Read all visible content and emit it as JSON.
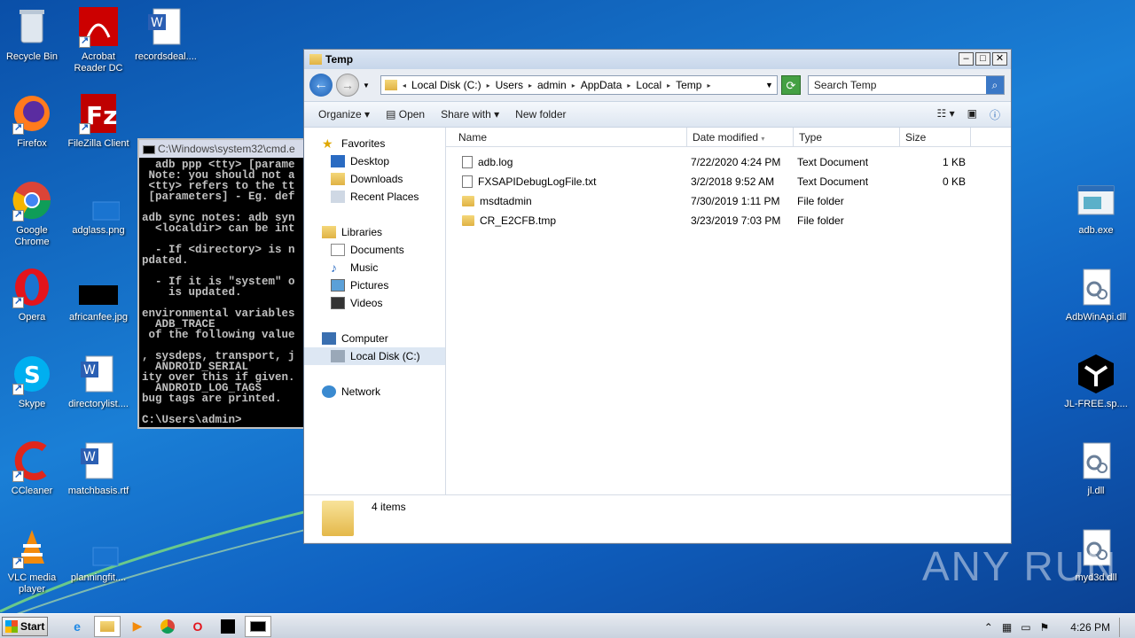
{
  "desktop": {
    "left_icons": [
      {
        "label": "Recycle Bin",
        "icon": "recycle-bin-icon"
      },
      {
        "label": "Acrobat Reader DC",
        "icon": "acrobat-icon"
      },
      {
        "label": "recordsdeal....",
        "icon": "word-doc-icon"
      },
      {
        "label": "Firefox",
        "icon": "firefox-icon"
      },
      {
        "label": "FileZilla Client",
        "icon": "filezilla-icon"
      },
      {
        "label": "Google Chrome",
        "icon": "chrome-icon"
      },
      {
        "label": "adglass.png",
        "icon": "image-file-icon"
      },
      {
        "label": "Opera",
        "icon": "opera-icon"
      },
      {
        "label": "africanfee.jpg",
        "icon": "image-file-icon"
      },
      {
        "label": "Skype",
        "icon": "skype-icon"
      },
      {
        "label": "directorylist....",
        "icon": "word-doc-icon"
      },
      {
        "label": "CCleaner",
        "icon": "ccleaner-icon"
      },
      {
        "label": "matchbasis.rtf",
        "icon": "word-doc-icon"
      },
      {
        "label": "VLC media player",
        "icon": "vlc-icon"
      },
      {
        "label": "planningfit....",
        "icon": "file-icon"
      }
    ],
    "right_icons": [
      {
        "label": "adb.exe",
        "icon": "exe-icon"
      },
      {
        "label": "AdbWinApi.dll",
        "icon": "dll-icon"
      },
      {
        "label": "JL-FREE.sp....",
        "icon": "package-icon"
      },
      {
        "label": "jl.dll",
        "icon": "dll-icon"
      },
      {
        "label": "myd3d.dll",
        "icon": "dll-icon"
      }
    ]
  },
  "cmd": {
    "title": "C:\\Windows\\system32\\cmd.e",
    "lines": "  adb ppp <tty> [parame\n Note: you should not a\n <tty> refers to the tt\n [parameters] - Eg. def\n\nadb sync notes: adb syn\n  <localdir> can be int\n\n  - If <directory> is n\npdated.\n\n  - If it is \"system\" o\n    is updated.\n\nenvironmental variables\n  ADB_TRACE\n of the following value\n\n, sysdeps, transport, j\n  ANDROID_SERIAL\nity over this if given.\n  ANDROID_LOG_TAGS\nbug tags are printed.\n\nC:\\Users\\admin>"
  },
  "explorer": {
    "title": "Temp",
    "breadcrumb": [
      "Local Disk (C:)",
      "Users",
      "admin",
      "AppData",
      "Local",
      "Temp"
    ],
    "search_placeholder": "Search Temp",
    "toolbar": {
      "organize": "Organize",
      "open": "Open",
      "share": "Share with",
      "new_folder": "New folder"
    },
    "nav": {
      "favorites": "Favorites",
      "desktop": "Desktop",
      "downloads": "Downloads",
      "recent": "Recent Places",
      "libraries": "Libraries",
      "documents": "Documents",
      "music": "Music",
      "pictures": "Pictures",
      "videos": "Videos",
      "computer": "Computer",
      "localdisk": "Local Disk (C:)",
      "network": "Network"
    },
    "columns": {
      "name": "Name",
      "date": "Date modified",
      "type": "Type",
      "size": "Size"
    },
    "files": [
      {
        "name": "adb.log",
        "date": "7/22/2020 4:24 PM",
        "type": "Text Document",
        "size": "1 KB",
        "kind": "doc"
      },
      {
        "name": "FXSAPIDebugLogFile.txt",
        "date": "3/2/2018 9:52 AM",
        "type": "Text Document",
        "size": "0 KB",
        "kind": "doc"
      },
      {
        "name": "msdtadmin",
        "date": "7/30/2019 1:11 PM",
        "type": "File folder",
        "size": "",
        "kind": "folder"
      },
      {
        "name": "CR_E2CFB.tmp",
        "date": "3/23/2019 7:03 PM",
        "type": "File folder",
        "size": "",
        "kind": "folder"
      }
    ],
    "item_count": "4 items"
  },
  "taskbar": {
    "start": "Start",
    "clock": "4:26 PM"
  },
  "watermark": "ANY RUN"
}
